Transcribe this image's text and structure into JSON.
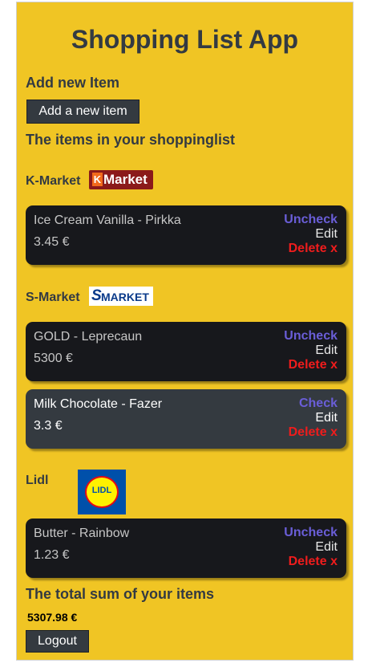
{
  "app": {
    "title": "Shopping List App"
  },
  "add_section": {
    "heading": "Add new Item",
    "button_label": "Add a new item"
  },
  "list_heading": "The items in your shoppinglist",
  "stores": [
    {
      "name": "K-Market",
      "logo_text": "Market",
      "logo_mark": "K",
      "items": [
        {
          "name": "Ice Cream Vanilla - Pirkka",
          "price": "3.45 €",
          "action": "Uncheck",
          "edit": "Edit",
          "delete": "Delete x"
        }
      ]
    },
    {
      "name": "S-Market",
      "logo_text": "MARKET",
      "logo_mark": "S",
      "items": [
        {
          "name": "GOLD - Leprecaun",
          "price": "5300 €",
          "action": "Uncheck",
          "edit": "Edit",
          "delete": "Delete x"
        },
        {
          "name": "Milk Chocolate - Fazer",
          "price": "3.3 €",
          "action": "Check",
          "edit": "Edit",
          "delete": "Delete x"
        }
      ]
    },
    {
      "name": "Lidl",
      "logo_text": "LIDL",
      "items": [
        {
          "name": "Butter - Rainbow",
          "price": "1.23 €",
          "action": "Uncheck",
          "edit": "Edit",
          "delete": "Delete x"
        }
      ]
    }
  ],
  "total": {
    "heading": "The total sum of your items",
    "value": "5307.98 €"
  },
  "logout_label": "Logout",
  "colors": {
    "background": "#f0c524",
    "card_checked": "#17181c",
    "card_unchecked": "#343a40",
    "action": "#6a5ed8",
    "delete": "#ef1c1c"
  }
}
